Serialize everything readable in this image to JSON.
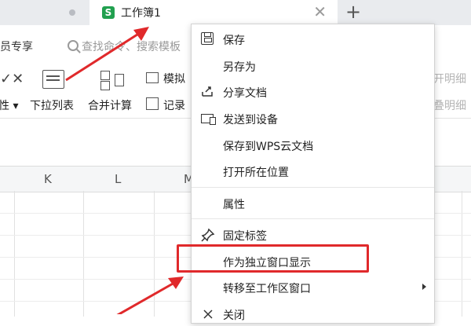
{
  "tabs": {
    "active_title": "工作簿1",
    "logo_letter": "S",
    "close_glyph": "✕",
    "add_glyph": "+"
  },
  "toolbar": {
    "member_text": "会员专享",
    "search_placeholder": "查找命令、搜索模板",
    "tools": {
      "attr_label": "性",
      "dropdown_label": "下拉列表",
      "merge_label": "合并计算",
      "simulate_label": "模拟",
      "record_label": "记录",
      "right_top": "开明细",
      "right_bottom": "叠明细"
    }
  },
  "sheet": {
    "columns": [
      "K",
      "L",
      "M"
    ]
  },
  "context_menu": {
    "items": [
      {
        "label": "保存",
        "icon": "save-icon"
      },
      {
        "label": "另存为"
      },
      {
        "label": "分享文档",
        "icon": "share-icon"
      },
      {
        "label": "发送到设备",
        "icon": "device-icon"
      },
      {
        "label": "保存到WPS云文档"
      },
      {
        "label": "打开所在位置"
      },
      {
        "label": "属性"
      },
      {
        "label": "固定标签",
        "icon": "pin-icon"
      },
      {
        "label": "作为独立窗口显示"
      },
      {
        "label": "转移至工作区窗口",
        "submenu": true
      },
      {
        "label": "关闭",
        "icon": "close-icon"
      }
    ]
  },
  "colors": {
    "annotation_red": "#e0292b",
    "logo_green": "#21a04f"
  }
}
